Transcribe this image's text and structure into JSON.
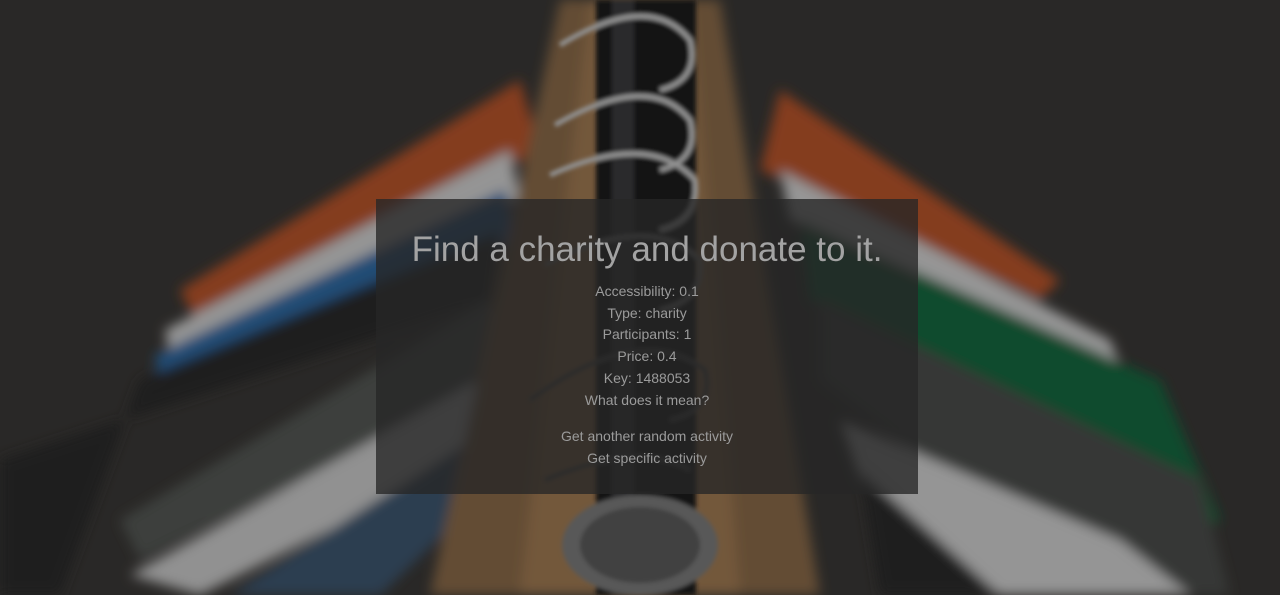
{
  "activity": {
    "title": "Find a charity and donate to it.",
    "fields": [
      {
        "label": "Accessibility",
        "value": "0.1"
      },
      {
        "label": "Type",
        "value": "charity"
      },
      {
        "label": "Participants",
        "value": "1"
      },
      {
        "label": "Price",
        "value": "0.4"
      },
      {
        "label": "Key",
        "value": "1488053"
      }
    ],
    "meaning_link": "What does it mean?"
  },
  "actions": {
    "random": "Get another random activity",
    "specific": "Get specific activity"
  },
  "background": {
    "subject": "clothes on hangers on a rail",
    "colors": {
      "base": "#373533",
      "orange": "#b8552a",
      "green": "#13683f",
      "wood": "#8a6a48",
      "card": "#262626"
    }
  }
}
